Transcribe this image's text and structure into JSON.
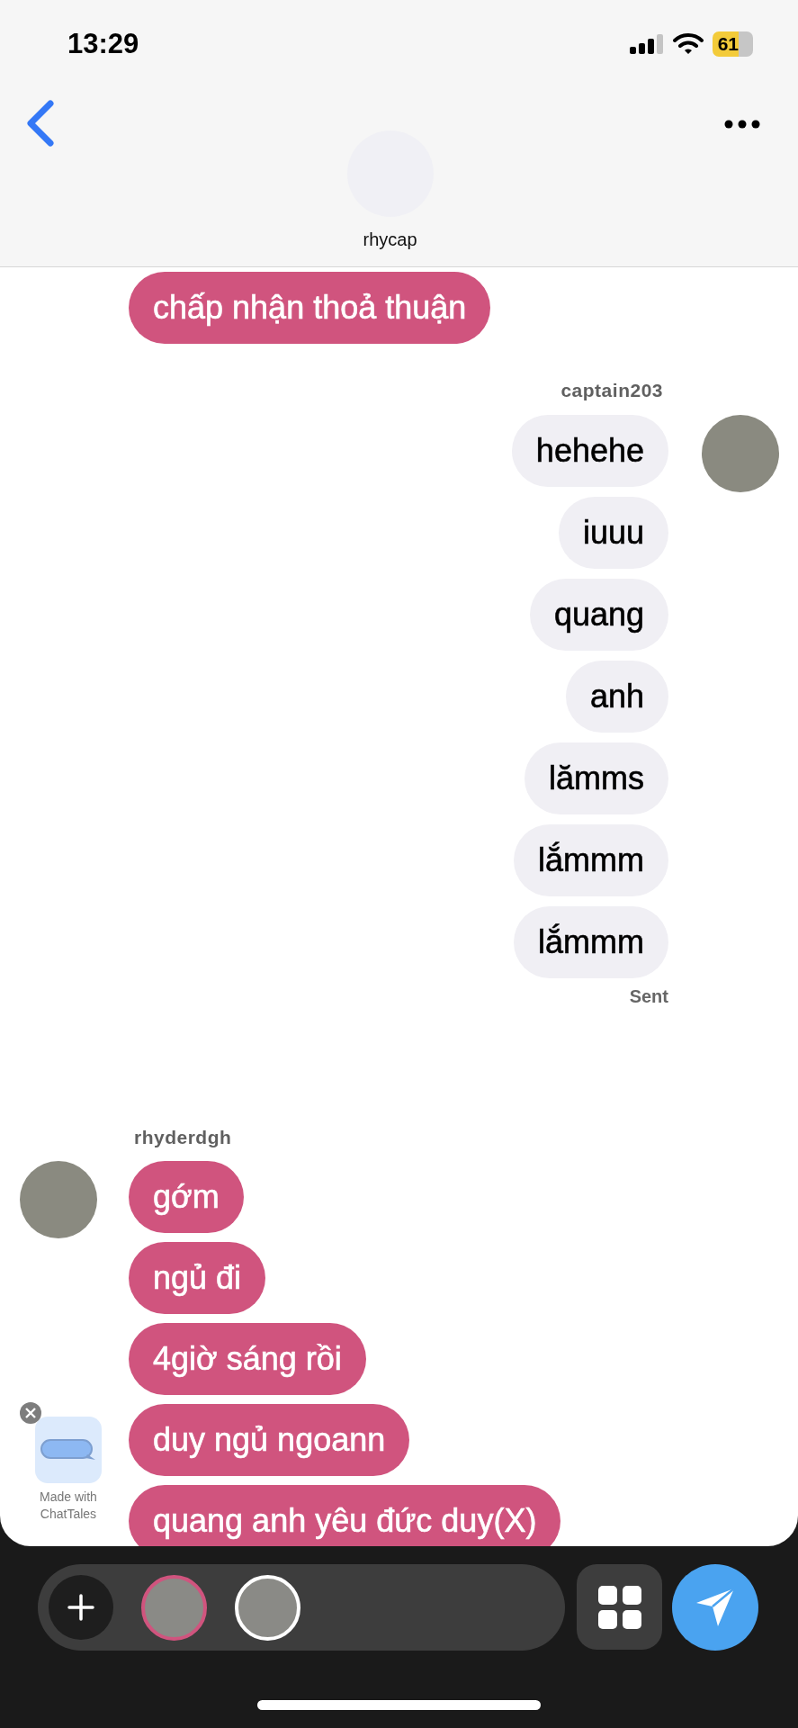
{
  "status_bar": {
    "time": "13:29",
    "battery": "61"
  },
  "header": {
    "name": "rhycap"
  },
  "groups": [
    {
      "kind": "received",
      "avatar": false,
      "messages": [
        "chấp nhận thoả thuận"
      ]
    },
    {
      "kind": "sent",
      "avatar": true,
      "sender": "captain203",
      "messages": [
        "hehehe",
        "iuuu",
        "quang",
        "anh",
        "lămms",
        "lắmmm",
        "lắmmm"
      ],
      "status": "Sent"
    },
    {
      "kind": "received",
      "avatar": true,
      "sender": "rhyderdgh",
      "messages": [
        "gớm",
        "ngủ đi",
        "4giờ sáng rồi",
        "duy ngủ ngoann",
        "quang anh yêu đức duy(X)"
      ]
    }
  ],
  "promo": {
    "text": "Made with ChatTales"
  },
  "composer": {
    "participants": [
      {
        "selected": true
      },
      {
        "selected": false
      }
    ]
  }
}
